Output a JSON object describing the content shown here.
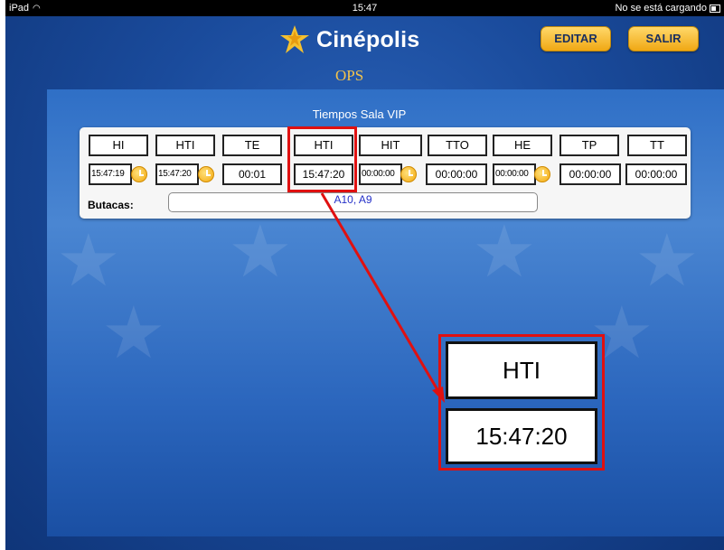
{
  "status_bar": {
    "device": "iPad",
    "time": "15:47",
    "battery_text": "No se está cargando"
  },
  "header": {
    "logo_text": "Cinépolis",
    "subtitle": "OPS",
    "edit_button": "EDITAR",
    "exit_button": "SALIR"
  },
  "table": {
    "title": "Tiempos Sala VIP",
    "headers": [
      "HI",
      "HTI",
      "TE",
      "HTI",
      "HIT",
      "TTO",
      "HE",
      "TP",
      "TT"
    ],
    "values": [
      "15:47:19",
      "15:47:20",
      "00:01",
      "15:47:20",
      "00:00:00",
      "00:00:00",
      "00:00:00",
      "00:00:00",
      "00:00:00"
    ],
    "butacas_label": "Butacas:",
    "butacas_value": "A10, A9"
  },
  "zoom": {
    "header": "HTI",
    "value": "15:47:20"
  },
  "colors": {
    "accent": "#f0a814",
    "highlight": "#e01010",
    "background": "#1a4b9c"
  }
}
